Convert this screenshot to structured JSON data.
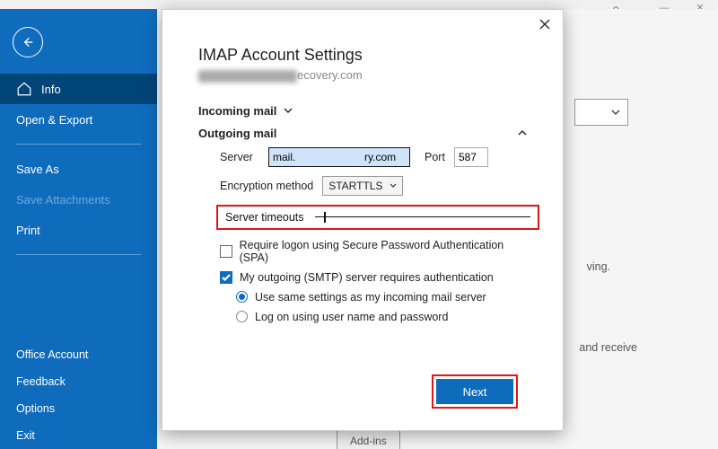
{
  "window": {
    "help": "?",
    "minimize": "—",
    "close": "✕"
  },
  "sidebar": {
    "items": [
      {
        "label": "Info",
        "active": true
      },
      {
        "label": "Open & Export"
      },
      {
        "label": "Save As"
      },
      {
        "label": "Save Attachments",
        "disabled": true
      },
      {
        "label": "Print"
      }
    ],
    "bottom_items": [
      {
        "label": "Office Account"
      },
      {
        "label": "Feedback"
      },
      {
        "label": "Options"
      },
      {
        "label": "Exit"
      }
    ]
  },
  "background": {
    "text_fragment_1": "ving.",
    "text_fragment_2": "and receive",
    "addins_tab": "Add-ins"
  },
  "dialog": {
    "title": "IMAP Account Settings",
    "subtitle_suffix": "ecovery.com",
    "incoming": {
      "label": "Incoming mail"
    },
    "outgoing": {
      "label": "Outgoing mail",
      "server_label": "Server",
      "server_value": "mail.                       ry.com",
      "port_label": "Port",
      "port_value": "587",
      "encryption_label": "Encryption method",
      "encryption_value": "STARTTLS",
      "timeout_label": "Server timeouts",
      "spa_label": "Require logon using Secure Password Authentication (SPA)",
      "spa_checked": false,
      "auth_label": "My outgoing (SMTP) server requires authentication",
      "auth_checked": true,
      "radio_same": "Use same settings as my incoming mail server",
      "radio_logon": "Log on using user name and password",
      "radio_selected": "same"
    },
    "next_button": "Next"
  }
}
